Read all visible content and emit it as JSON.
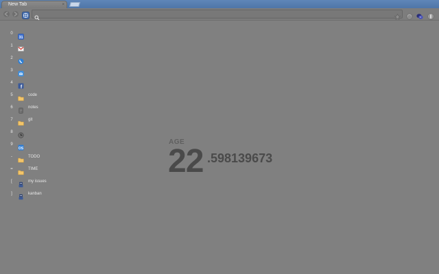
{
  "tab": {
    "title": "New Tab",
    "close_glyph": "×"
  },
  "toolbar": {
    "back_icon": "back-arrow-icon",
    "forward_icon": "forward-arrow-icon",
    "home_icon": "globe-icon",
    "omnibox": {
      "value": "",
      "search_icon": "search-icon",
      "star_icon": "star-icon"
    },
    "extensions": [
      "extension-icon",
      "chat-extension-icon",
      "settings-wrench-icon"
    ]
  },
  "bookmarks": [
    {
      "key": "0",
      "label": "",
      "icon": "calendar-icon"
    },
    {
      "key": "1",
      "label": "",
      "icon": "gmail-icon"
    },
    {
      "key": "2",
      "label": "",
      "icon": "phone-icon"
    },
    {
      "key": "3",
      "label": "",
      "icon": "mail-icon"
    },
    {
      "key": "4",
      "label": "",
      "icon": "facebook-icon"
    },
    {
      "key": "5",
      "label": "code",
      "icon": "folder-icon"
    },
    {
      "key": "6",
      "label": "notes",
      "icon": "notes-icon"
    },
    {
      "key": "7",
      "label": "git",
      "icon": "folder-icon"
    },
    {
      "key": "8",
      "label": "",
      "icon": "clock-icon"
    },
    {
      "key": "9",
      "label": "",
      "icon": "exchange-icon"
    },
    {
      "key": "-",
      "label": "TODO",
      "icon": "folder-icon"
    },
    {
      "key": "=",
      "label": "TIME",
      "icon": "folder-icon"
    },
    {
      "key": "[",
      "label": "my issues",
      "icon": "robot-icon"
    },
    {
      "key": "]",
      "label": "kanban",
      "icon": "robot-icon"
    }
  ],
  "age": {
    "label": "AGE",
    "integer": "22",
    "fraction": ".598139673"
  },
  "colors": {
    "background": "#808080",
    "tabstrip": "#5f86b8",
    "age_text": "#4a4a4a"
  }
}
